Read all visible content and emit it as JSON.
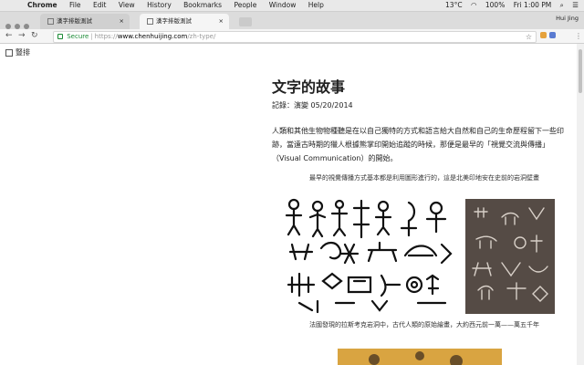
{
  "menubar": {
    "app_name": "Chrome",
    "menus": [
      "File",
      "Edit",
      "View",
      "History",
      "Bookmarks",
      "People",
      "Window",
      "Help"
    ],
    "battery": "100%",
    "clock": "Fri 1:00 PM",
    "temp": "13°C"
  },
  "tabs": [
    {
      "label": "漢字排版測試",
      "active": false
    },
    {
      "label": "漢字排版測試",
      "active": true
    }
  ],
  "user": "Hui Jing",
  "address": {
    "secure_label": "Secure",
    "protocol": "https://",
    "host": "www.chenhuijing.com",
    "path": "/zh-type/"
  },
  "page": {
    "vertical_toggle_label": "豎排",
    "title": "文字的故事",
    "date_line": "記錄：演變 05/20/2014",
    "paragraph1": "人類和其他生物物種聽是在以自己獨特的方式和語言給大自然和自己的生命歷程留下一些印跡，當遠古時期的獵人根據熊掌印開始追蹤的時候，那便是最早的「視覺交流與傳播」（Visual Communication）的開始。",
    "caption1": "最早的視覺傳播方式基本都是利用圖形進行的，這是北美印地安在史前的岩洞壁畫",
    "caption2": "法國發現的拉斯考克岩洞中，古代人類的原始繪畫，大約西元前一萬——萬五千年"
  },
  "colors": {
    "secure_green": "#1a8a34",
    "rock_art_bg": "#554b45",
    "painting_bg": "#d9a441"
  }
}
